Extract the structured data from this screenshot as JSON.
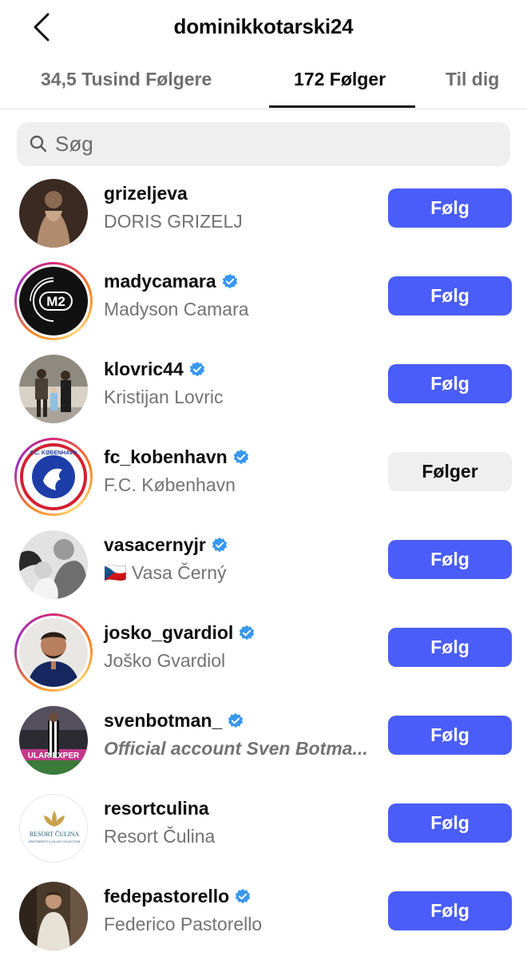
{
  "header": {
    "title": "dominikkotarski24",
    "back_icon": "chevron-left-icon"
  },
  "tabs": [
    {
      "label": "34,5 Tusind Følgere",
      "active": false
    },
    {
      "label": "172 Følger",
      "active": true
    },
    {
      "label": "Til dig",
      "active": false
    }
  ],
  "search": {
    "placeholder": "Søg",
    "value": "",
    "icon": "search-icon"
  },
  "colors": {
    "accent": "#4a5df9",
    "verified": "#3897f0",
    "following_bg": "#efeff0"
  },
  "rows": [
    {
      "username": "grizeljeva",
      "fullname": "DORIS GRIZELJ",
      "verified": false,
      "button": "Følg",
      "following": false,
      "story_ring": false
    },
    {
      "username": "madycamara",
      "fullname": "Madyson Camara",
      "verified": true,
      "button": "Følg",
      "following": false,
      "story_ring": true
    },
    {
      "username": "klovric44",
      "fullname": "Kristijan Lovric",
      "verified": true,
      "button": "Følg",
      "following": false,
      "story_ring": false
    },
    {
      "username": "fc_kobenhavn",
      "fullname": "F.C. København",
      "verified": true,
      "button": "Følger",
      "following": true,
      "story_ring": true
    },
    {
      "username": "vasacernyjr",
      "fullname": "🇨🇿 Vasa Černý",
      "verified": true,
      "button": "Følg",
      "following": false,
      "story_ring": false
    },
    {
      "username": "josko_gvardiol",
      "fullname": "Joško Gvardiol",
      "verified": true,
      "button": "Følg",
      "following": false,
      "story_ring": true
    },
    {
      "username": "svenbotman_",
      "fullname": "Official account Sven Botma...",
      "verified": true,
      "button": "Følg",
      "following": false,
      "story_ring": false
    },
    {
      "username": "resortculina",
      "fullname": "Resort Čulina",
      "verified": false,
      "button": "Følg",
      "following": false,
      "story_ring": false
    },
    {
      "username": "fedepastorello",
      "fullname": "Federico Pastorello",
      "verified": true,
      "button": "Følg",
      "following": false,
      "story_ring": false
    }
  ],
  "avatar_text": {
    "madycamara_logo": "M2",
    "fc_kobenhavn_logo": "F.C. KØBENHAVN",
    "resortculina_logo": "RESORT ČULINA",
    "resortculina_logo_sub": "APARTMENTS & VILLAS COLLECTION",
    "svenbotman_banner": "ULAR EXPER"
  }
}
